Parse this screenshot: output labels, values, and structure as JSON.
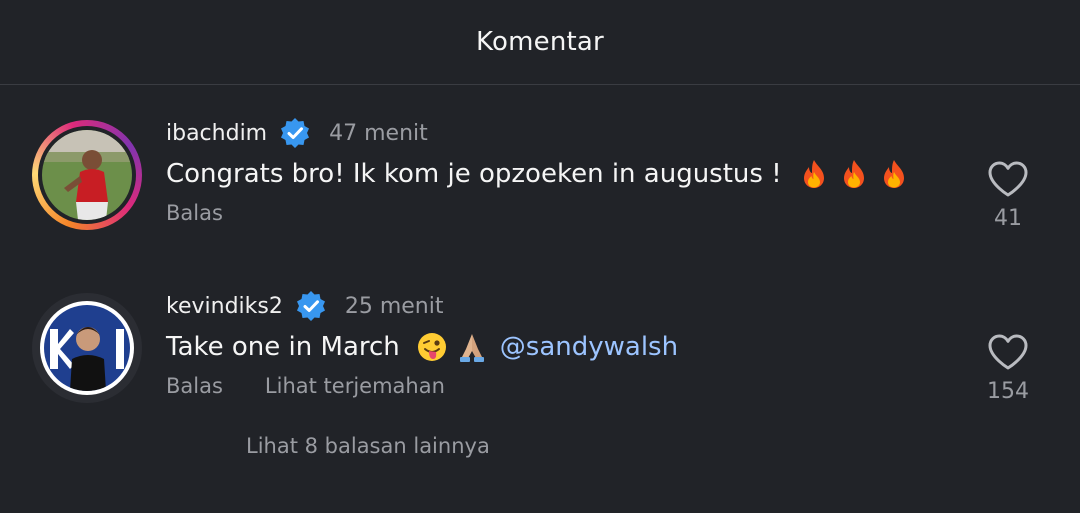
{
  "header": {
    "title": "Komentar"
  },
  "comments": [
    {
      "username": "ibachdim",
      "time": "47 menit",
      "text": "Congrats bro! Ik kom je opzoeken in augustus !",
      "emojis": [
        "fire-emoji",
        "fire-emoji",
        "fire-emoji"
      ],
      "reply_label": "Balas",
      "like_count": "41"
    },
    {
      "username": "kevindiks2",
      "time": "25 menit",
      "text": "Take one in March",
      "emojis": [
        "winking-tongue-emoji",
        "folded-hands-emoji"
      ],
      "mention": "@sandywalsh",
      "reply_label": "Balas",
      "translate_label": "Lihat terjemahan",
      "like_count": "154"
    }
  ],
  "view_more_replies": "Lihat 8 balasan lainnya",
  "colors": {
    "background": "#212328",
    "muted_text": "#9a9ca2",
    "verified_blue": "#3897f0",
    "mention_blue": "#9cc4ff"
  }
}
